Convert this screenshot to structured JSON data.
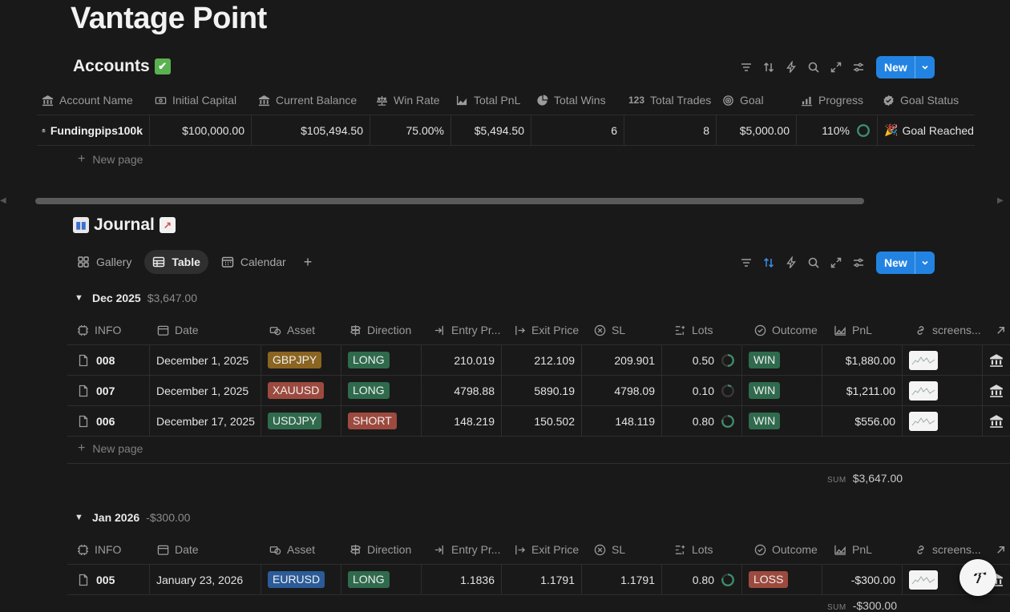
{
  "page": {
    "title": "Vantage Point"
  },
  "accounts": {
    "title": "Accounts",
    "title_emoji": "✅",
    "new_label": "New",
    "columns": [
      "Account Name",
      "Initial Capital",
      "Current Balance",
      "Win Rate",
      "Total PnL",
      "Total Wins",
      "Total Trades",
      "Goal",
      "Progress",
      "Goal Status"
    ],
    "row": {
      "account_name": "Fundingpips100k",
      "initial_capital": "$100,000.00",
      "current_balance": "$105,494.50",
      "win_rate": "75.00%",
      "total_pnl": "$5,494.50",
      "total_wins": "6",
      "total_trades": "8",
      "goal": "$5,000.00",
      "progress": "110%",
      "progress_value": 1.1,
      "goal_status": "Goal Reached!",
      "goal_status_emoji": "🎉"
    },
    "new_page_label": "New page"
  },
  "journal": {
    "title": "Journal",
    "new_label": "New",
    "views": [
      {
        "label": "Gallery",
        "icon": "gallery-icon"
      },
      {
        "label": "Table",
        "icon": "table-icon",
        "active": true
      },
      {
        "label": "Calendar",
        "icon": "calendar-icon"
      }
    ],
    "columns": [
      "INFO",
      "Date",
      "Asset",
      "Direction",
      "Entry Pr...",
      "Exit Price",
      "SL",
      "Lots",
      "Outcome",
      "PnL",
      "screens..."
    ],
    "groups": [
      {
        "name": "Dec 2025",
        "sum": "$3,647.00",
        "rows": [
          {
            "info": "008",
            "date": "December 1, 2025",
            "asset": "GBPJPY",
            "asset_color": "orange",
            "direction": "LONG",
            "direction_color": "green",
            "entry": "210.019",
            "exit": "212.109",
            "sl": "209.901",
            "lots": "0.50",
            "lots_progress": 0.5,
            "outcome": "WIN",
            "outcome_color": "green",
            "pnl": "$1,880.00"
          },
          {
            "info": "007",
            "date": "December 1, 2025",
            "asset": "XAUUSD",
            "asset_color": "red",
            "direction": "LONG",
            "direction_color": "green",
            "entry": "4798.88",
            "exit": "5890.19",
            "sl": "4798.09",
            "lots": "0.10",
            "lots_progress": 0.1,
            "outcome": "WIN",
            "outcome_color": "green",
            "pnl": "$1,211.00"
          },
          {
            "info": "006",
            "date": "December 17, 2025",
            "asset": "USDJPY",
            "asset_color": "green",
            "direction": "SHORT",
            "direction_color": "red",
            "entry": "148.219",
            "exit": "150.502",
            "sl": "148.119",
            "lots": "0.80",
            "lots_progress": 0.8,
            "outcome": "WIN",
            "outcome_color": "green",
            "pnl": "$556.00"
          }
        ],
        "new_page_label": "New page",
        "sum_label": "SUM",
        "sum_value": "$3,647.00"
      },
      {
        "name": "Jan 2026",
        "sum": "-$300.00",
        "rows": [
          {
            "info": "005",
            "date": "January 23, 2026",
            "asset": "EURUSD",
            "asset_color": "blue",
            "direction": "LONG",
            "direction_color": "green",
            "entry": "1.1836",
            "exit": "1.1791",
            "sl": "1.1791",
            "lots": "0.80",
            "lots_progress": 0.8,
            "outcome": "LOSS",
            "outcome_color": "red",
            "pnl": "-$300.00"
          }
        ],
        "sum_label": "SUM",
        "sum_value": "-$300.00"
      }
    ]
  },
  "colors": {
    "accent": "#2383e2",
    "background": "#191919",
    "ring": "#3d8f6e"
  }
}
